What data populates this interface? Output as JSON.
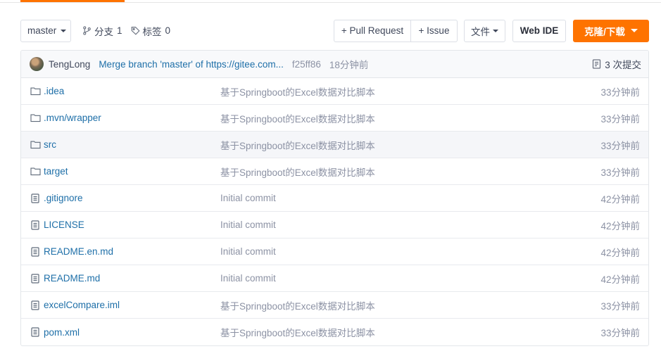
{
  "toolbar": {
    "branch": "master",
    "branches_label": "分支",
    "branches_count": "1",
    "tags_label": "标签",
    "tags_count": "0",
    "pull_request_label": "+ Pull Request",
    "issue_label": "+ Issue",
    "file_label": "文件",
    "web_ide_label": "Web IDE",
    "clone_label": "克隆/下载",
    "accent_color": "#fe7300"
  },
  "commit": {
    "author": "TengLong",
    "message": "Merge branch 'master' of https://gitee.com...",
    "hash": "f25ff86",
    "time": "18分钟前",
    "count_label": "3 次提交"
  },
  "files": [
    {
      "name": ".idea",
      "type": "folder",
      "message": "基于Springboot的Excel数据对比脚本",
      "time": "33分钟前"
    },
    {
      "name": ".mvn/wrapper",
      "type": "folder",
      "message": "基于Springboot的Excel数据对比脚本",
      "time": "33分钟前"
    },
    {
      "name": "src",
      "type": "folder",
      "message": "基于Springboot的Excel数据对比脚本",
      "time": "33分钟前"
    },
    {
      "name": "target",
      "type": "folder",
      "message": "基于Springboot的Excel数据对比脚本",
      "time": "33分钟前"
    },
    {
      "name": ".gitignore",
      "type": "file",
      "message": "Initial commit",
      "time": "42分钟前"
    },
    {
      "name": "LICENSE",
      "type": "file",
      "message": "Initial commit",
      "time": "42分钟前"
    },
    {
      "name": "README.en.md",
      "type": "file",
      "message": "Initial commit",
      "time": "42分钟前"
    },
    {
      "name": "README.md",
      "type": "file",
      "message": "Initial commit",
      "time": "42分钟前"
    },
    {
      "name": "excelCompare.iml",
      "type": "file",
      "message": "基于Springboot的Excel数据对比脚本",
      "time": "33分钟前"
    },
    {
      "name": "pom.xml",
      "type": "file",
      "message": "基于Springboot的Excel数据对比脚本",
      "time": "33分钟前"
    }
  ]
}
